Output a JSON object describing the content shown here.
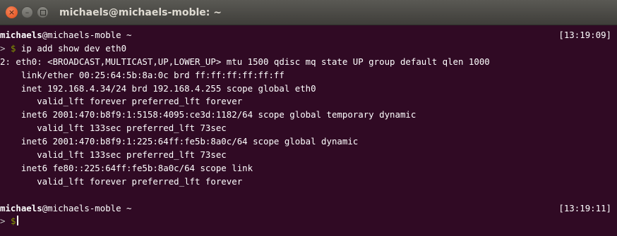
{
  "window": {
    "title": "michaels@michaels-moble: ~",
    "close_glyph": "×",
    "minimize_glyph": "–"
  },
  "terminal": {
    "prompt1": {
      "user": "michaels",
      "host": "@michaels-moble ~",
      "timestamp": "[13:19:09]"
    },
    "command": {
      "arrow": ">",
      "dollar": "$",
      "text": "ip add show dev eth0"
    },
    "output": [
      "2: eth0: <BROADCAST,MULTICAST,UP,LOWER_UP> mtu 1500 qdisc mq state UP group default qlen 1000",
      "    link/ether 00:25:64:5b:8a:0c brd ff:ff:ff:ff:ff:ff",
      "    inet 192.168.4.34/24 brd 192.168.4.255 scope global eth0",
      "       valid_lft forever preferred_lft forever",
      "    inet6 2001:470:b8f9:1:5158:4095:ce3d:1182/64 scope global temporary dynamic",
      "       valid_lft 133sec preferred_lft 73sec",
      "    inet6 2001:470:b8f9:1:225:64ff:fe5b:8a0c/64 scope global dynamic",
      "       valid_lft 133sec preferred_lft 73sec",
      "    inet6 fe80::225:64ff:fe5b:8a0c/64 scope link",
      "       valid_lft forever preferred_lft forever"
    ],
    "prompt2": {
      "user": "michaels",
      "host": "@michaels-moble ~",
      "timestamp": "[13:19:11]"
    },
    "next_prompt": {
      "arrow": ">",
      "dollar": "$"
    }
  },
  "colors": {
    "background": "#300a24",
    "text": "#ffffff",
    "dollar": "#859900"
  }
}
